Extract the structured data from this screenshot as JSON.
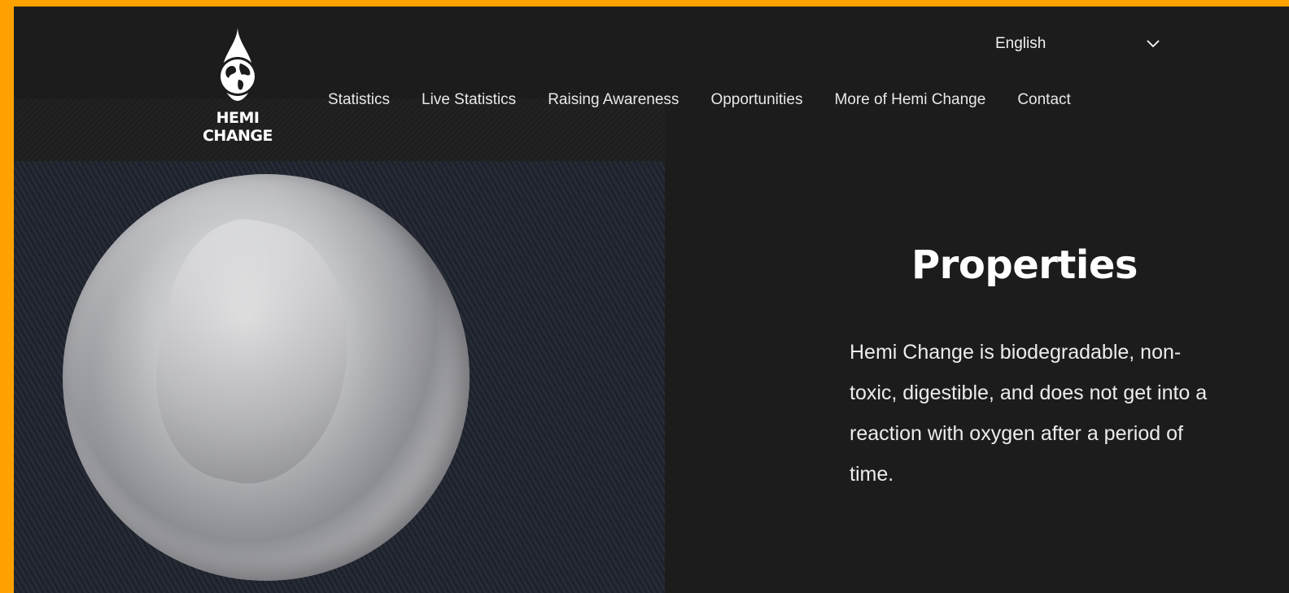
{
  "brand": {
    "name": "HEMI CHANGE"
  },
  "language": {
    "selected": "English"
  },
  "nav": {
    "items": [
      {
        "label": "Statistics"
      },
      {
        "label": "Live Statistics"
      },
      {
        "label": "Raising Awareness"
      },
      {
        "label": "Opportunities"
      },
      {
        "label": "More of Hemi Change"
      },
      {
        "label": "Contact"
      }
    ]
  },
  "section": {
    "title": "Properties",
    "body": "Hemi Change is biodegradable, non-toxic, digestible, and does not get into a reaction with oxygen after a period of time."
  },
  "colors": {
    "frame_border": "#FFA200",
    "background": "#1c1c1c",
    "text": "#ffffff"
  },
  "icons": {
    "logo": "globe-droplet-icon",
    "language_dropdown": "chevron-down-icon"
  }
}
